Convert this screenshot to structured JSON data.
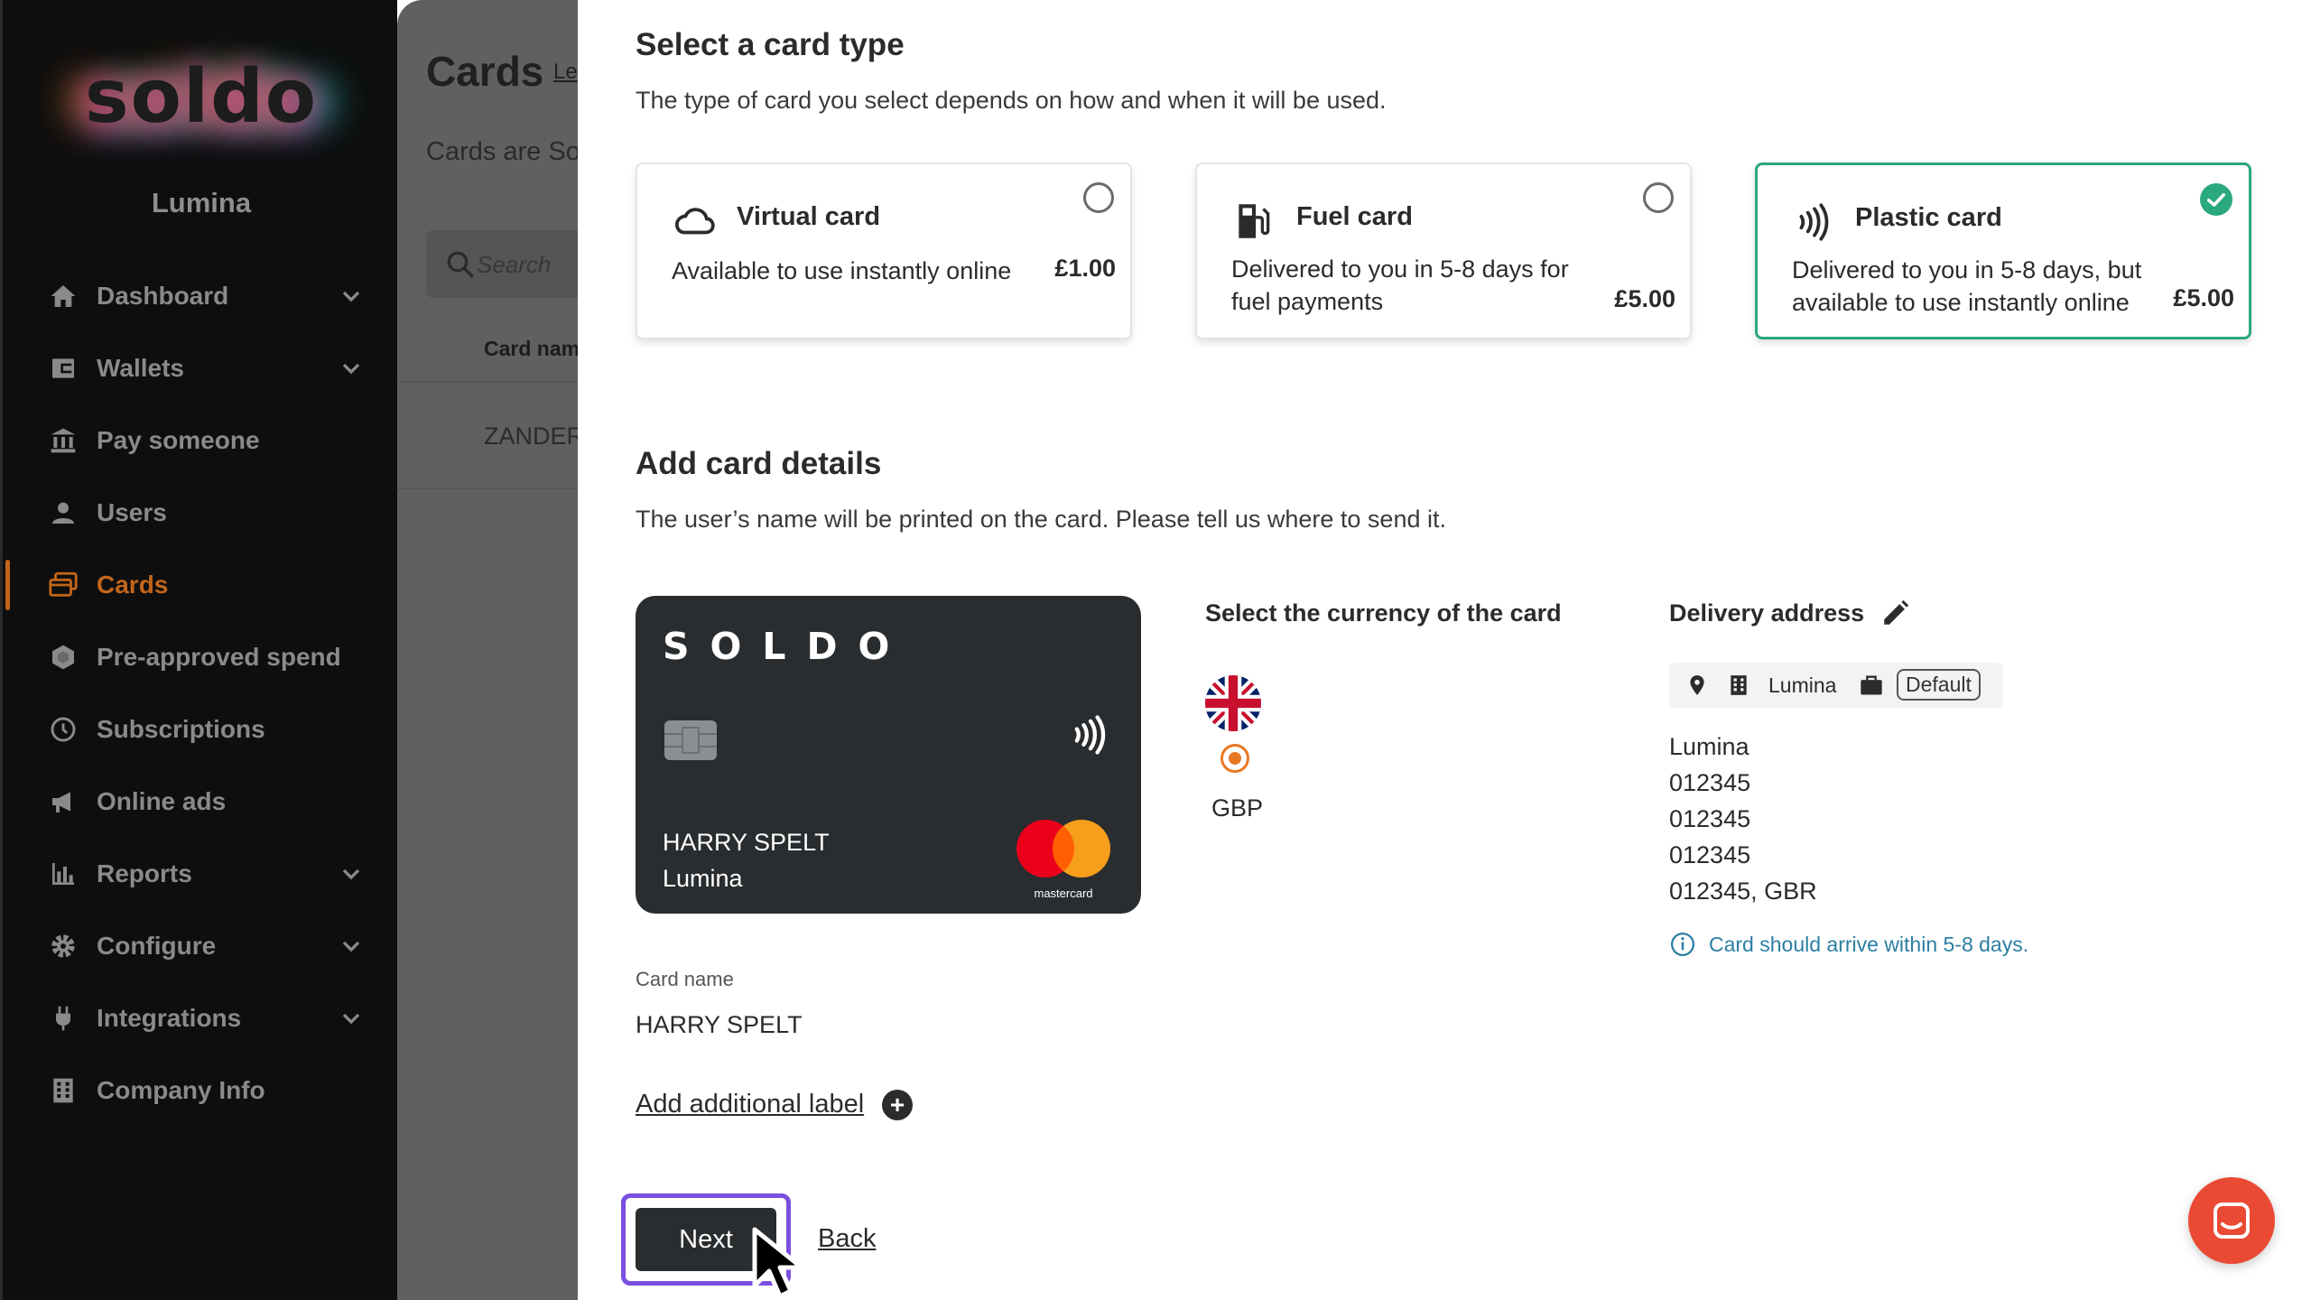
{
  "sidebar": {
    "logo": "soldo",
    "org_name": "Lumina",
    "items": [
      {
        "label": "Dashboard",
        "icon": "home-icon",
        "has_chevron": true
      },
      {
        "label": "Wallets",
        "icon": "wallet-icon",
        "has_chevron": true
      },
      {
        "label": "Pay someone",
        "icon": "bank-icon",
        "has_chevron": false
      },
      {
        "label": "Users",
        "icon": "user-icon",
        "has_chevron": false
      },
      {
        "label": "Cards",
        "icon": "cards-icon",
        "has_chevron": false,
        "active": true
      },
      {
        "label": "Pre-approved spend",
        "icon": "hexagon-icon",
        "has_chevron": false
      },
      {
        "label": "Subscriptions",
        "icon": "clock-icon",
        "has_chevron": false
      },
      {
        "label": "Online ads",
        "icon": "megaphone-icon",
        "has_chevron": false
      },
      {
        "label": "Reports",
        "icon": "bar-chart-icon",
        "has_chevron": true
      },
      {
        "label": "Configure",
        "icon": "gear-icon",
        "has_chevron": true
      },
      {
        "label": "Integrations",
        "icon": "plug-icon",
        "has_chevron": true
      },
      {
        "label": "Company Info",
        "icon": "building-icon",
        "has_chevron": false
      }
    ]
  },
  "background_page": {
    "title": "Cards",
    "learn_link": "Le",
    "subtitle": "Cards are So",
    "search_placeholder": "Search",
    "column_header": "Card nam",
    "row_value": "ZANDER"
  },
  "modal": {
    "card_type_section": {
      "title": "Select a card type",
      "description": "The type of card you select depends on how and when it will be used.",
      "options": [
        {
          "name": "Virtual card",
          "description": "Available to use instantly online",
          "price": "£1.00",
          "selected": false,
          "icon": "cloud-icon"
        },
        {
          "name": "Fuel card",
          "description": "Delivered to you in 5-8 days for fuel payments",
          "price": "£5.00",
          "selected": false,
          "icon": "fuel-pump-icon"
        },
        {
          "name": "Plastic card",
          "description": "Delivered to you in 5-8 days, but available to use instantly online",
          "price": "£5.00",
          "selected": true,
          "icon": "contactless-icon"
        }
      ]
    },
    "details_section": {
      "title": "Add card details",
      "description": "The user’s name will be printed on the card. Please tell us where to send it."
    },
    "card_preview": {
      "brand": "SOLDO",
      "holder_name": "HARRY SPELT",
      "organization": "Lumina",
      "network_label": "mastercard"
    },
    "currency": {
      "label": "Select the currency of the card",
      "options": [
        {
          "code": "GBP",
          "selected": true
        }
      ]
    },
    "delivery": {
      "label": "Delivery address",
      "chip_name": "Lumina",
      "chip_badge": "Default",
      "address_lines": [
        "Lumina",
        "012345",
        "012345",
        "012345",
        "012345, GBR"
      ],
      "note": "Card should arrive within 5-8 days."
    },
    "card_name": {
      "label": "Card name",
      "value": "HARRY SPELT"
    },
    "add_label_link": "Add additional label",
    "next_button": "Next",
    "back_link": "Back"
  },
  "colors": {
    "accent_orange": "#c2651a",
    "selected_green": "#2aa87e",
    "focus_purple": "#7b4fe0",
    "info_blue": "#2c7ea3",
    "chat_red": "#ea4a34"
  }
}
